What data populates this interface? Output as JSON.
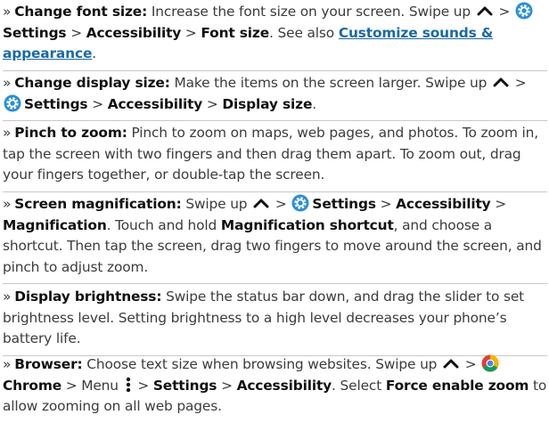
{
  "items": [
    {
      "title": "Change font size:",
      "t1": " Increase the font size on your screen. Swipe up ",
      "sep": " > ",
      "settings": "Settings",
      "gt": " > ",
      "accessibility": "Accessibility",
      "font_size": "Font size",
      "t2": ". See also ",
      "link": "Customize sounds & appearance",
      "t3": "."
    },
    {
      "title": "Change display size:",
      "t1": " Make the items on the screen larger. Swipe up ",
      "sep": " > ",
      "settings": "Settings",
      "gt": " > ",
      "accessibility": "Accessibility",
      "display_size": "Display size",
      "t2": "."
    },
    {
      "title": "Pinch to zoom:",
      "t1": " Pinch to zoom on maps, web pages, and photos. To zoom in, tap the screen with two fingers and then drag them apart. To zoom out, drag your fingers together, or double-tap the screen."
    },
    {
      "title": "Screen magnification:",
      "t1": " Swipe up ",
      "sep": " > ",
      "settings": "Settings",
      "gt": " > ",
      "accessibility": "Accessibility",
      "magnification": "Magnification",
      "t2": ". Touch and hold ",
      "shortcut": "Magnification shortcut",
      "t3": ", and choose a shortcut. Then tap the screen, drag two fingers to move around the screen, and pinch to adjust zoom."
    },
    {
      "title": "Display brightness:",
      "t1": " Swipe the status bar down, and drag the slider to set brightness level. Setting brightness to a high level decreases your phone’s battery life."
    },
    {
      "title": "Browser:",
      "t1": " Choose text size when browsing websites. Swipe up ",
      "sep": " > ",
      "chrome": "Chrome",
      "menu": " > Menu ",
      "settings": "Settings",
      "gt": " > ",
      "accessibility": "Accessibility",
      "t2": ". Select ",
      "force_zoom": "Force enable zoom",
      "t3": " to allow zooming on all web pages."
    }
  ],
  "bullet": "»",
  "colors": {
    "text": "#3b3b3b",
    "bold": "#111111",
    "link": "#1a6aa5",
    "settings_icon": "#2a8fd6",
    "divider": "#c8c8c8"
  },
  "icons": [
    "caret-up-icon",
    "settings-gear-icon",
    "chrome-icon",
    "menu-dots-icon"
  ]
}
